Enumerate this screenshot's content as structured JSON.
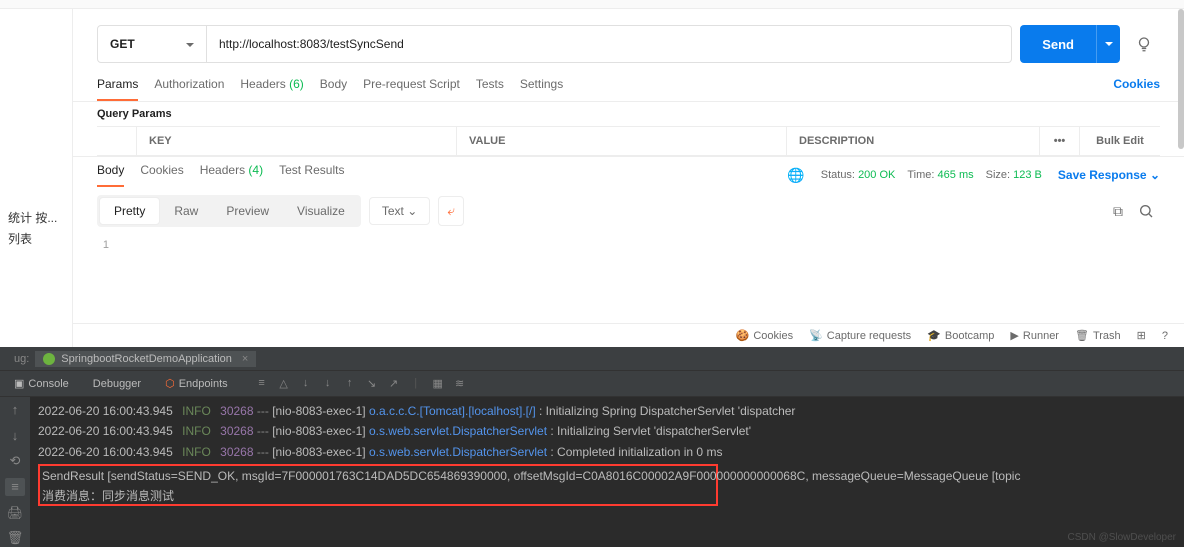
{
  "sidebar": {
    "item1": "统计 按...",
    "item2": "列表"
  },
  "request": {
    "method": "GET",
    "url": "http://localhost:8083/testSyncSend",
    "send_label": "Send"
  },
  "tabs": {
    "params": "Params",
    "auth": "Authorization",
    "headers": "Headers",
    "headers_count": "(6)",
    "body": "Body",
    "prereq": "Pre-request Script",
    "tests": "Tests",
    "settings": "Settings",
    "cookies": "Cookies"
  },
  "query_label": "Query Params",
  "table": {
    "key": "KEY",
    "value": "VALUE",
    "description": "DESCRIPTION",
    "bulk_edit": "Bulk Edit"
  },
  "response": {
    "body": "Body",
    "cookies": "Cookies",
    "headers": "Headers",
    "headers_count": "(4)",
    "tests": "Test Results",
    "status_label": "Status:",
    "status_value": "200 OK",
    "time_label": "Time:",
    "time_value": "465 ms",
    "size_label": "Size:",
    "size_value": "123 B",
    "save": "Save Response"
  },
  "format": {
    "pretty": "Pretty",
    "raw": "Raw",
    "preview": "Preview",
    "visualize": "Visualize",
    "text": "Text"
  },
  "code": {
    "line1": "1"
  },
  "footer": {
    "cookies": "Cookies",
    "capture": "Capture requests",
    "bootcamp": "Bootcamp",
    "runner": "Runner",
    "trash": "Trash"
  },
  "ide": {
    "prefix": "ug:",
    "app_name": "SpringbootRocketDemoApplication",
    "console": "Console",
    "debugger": "Debugger",
    "endpoints": "Endpoints",
    "logs": [
      {
        "ts": "2022-06-20 16:00:43.945",
        "level": "INFO",
        "pid": "30268",
        "dash": "---",
        "thread": "[nio-8083-exec-1]",
        "class": "o.a.c.c.C.[Tomcat].[localhost].[/]",
        "msg": ": Initializing Spring DispatcherServlet 'dispatcher"
      },
      {
        "ts": "2022-06-20 16:00:43.945",
        "level": "INFO",
        "pid": "30268",
        "dash": "---",
        "thread": "[nio-8083-exec-1]",
        "class": "o.s.web.servlet.DispatcherServlet",
        "msg": ": Initializing Servlet 'dispatcherServlet'"
      },
      {
        "ts": "2022-06-20 16:00:43.945",
        "level": "INFO",
        "pid": "30268",
        "dash": "---",
        "thread": "[nio-8083-exec-1]",
        "class": "o.s.web.servlet.DispatcherServlet",
        "msg": ": Completed initialization in 0 ms"
      }
    ],
    "highlight1": "SendResult [sendStatus=SEND_OK, msgId=7F000001763C14DAD5DC654869390000, offsetMsgId=C0A8016C00002A9F000000000000068C, messageQueue=MessageQueue [topic",
    "highlight2": "消费消息：同步消息测试"
  },
  "watermark": "CSDN @SlowDeveloper"
}
